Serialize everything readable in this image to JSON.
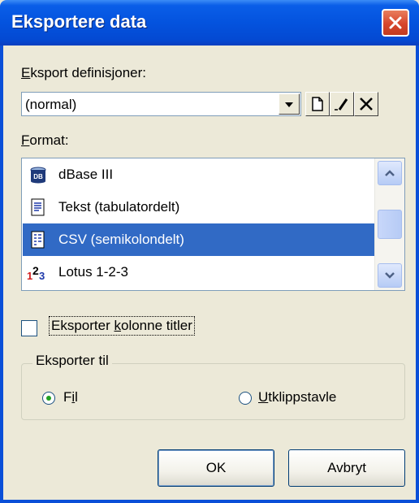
{
  "window": {
    "title": "Eksportere data"
  },
  "export_definitions": {
    "label": "Eksport definisjoner:",
    "label_mnemonic": "E",
    "label_rest": "ksport definisjoner:",
    "selected_value": "(normal)",
    "tools": [
      "new-icon",
      "edit-icon",
      "delete-icon"
    ]
  },
  "format": {
    "label": "Format:",
    "label_mnemonic": "F",
    "label_rest": "ormat:",
    "items": [
      {
        "label": "dBase III",
        "icon": "dbase-icon"
      },
      {
        "label": "Tekst (tabulatordelt)",
        "icon": "text-file-icon"
      },
      {
        "label": "CSV (semikolondelt)",
        "icon": "csv-file-icon",
        "selected": true
      },
      {
        "label": "Lotus 1-2-3",
        "icon": "lotus-icon"
      }
    ]
  },
  "export_column_titles": {
    "label": "Eksporter kolonne titler",
    "label_pre": "Eksporter ",
    "label_mnemonic": "k",
    "label_post": "olonne titler",
    "checked": false
  },
  "export_to": {
    "group_label": "Eksporter til",
    "options": [
      {
        "label": "Fil",
        "label_pre": "F",
        "label_mnemonic": "i",
        "label_post": "l",
        "selected": true
      },
      {
        "label": "Utklippstavle",
        "label_pre": "",
        "label_mnemonic": "U",
        "label_post": "tklippstavle",
        "selected": false
      }
    ]
  },
  "buttons": {
    "ok": "OK",
    "cancel": "Avbryt"
  },
  "colors": {
    "selection": "#316ac5",
    "titlebar": "#0453de",
    "close": "#d7462c"
  }
}
